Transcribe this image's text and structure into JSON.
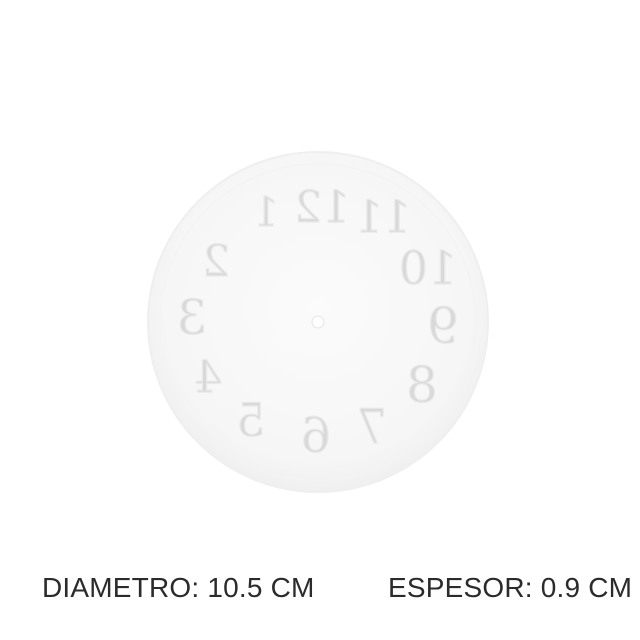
{
  "product_image": {
    "numerals": [
      "1",
      "12",
      "11",
      "10",
      "9",
      "8",
      "7",
      "6",
      "5",
      "4",
      "3",
      "2"
    ]
  },
  "captions": {
    "diameter": "DIAMETRO: 10.5 CM",
    "thickness": "ESPESOR: 0.9 CM"
  }
}
